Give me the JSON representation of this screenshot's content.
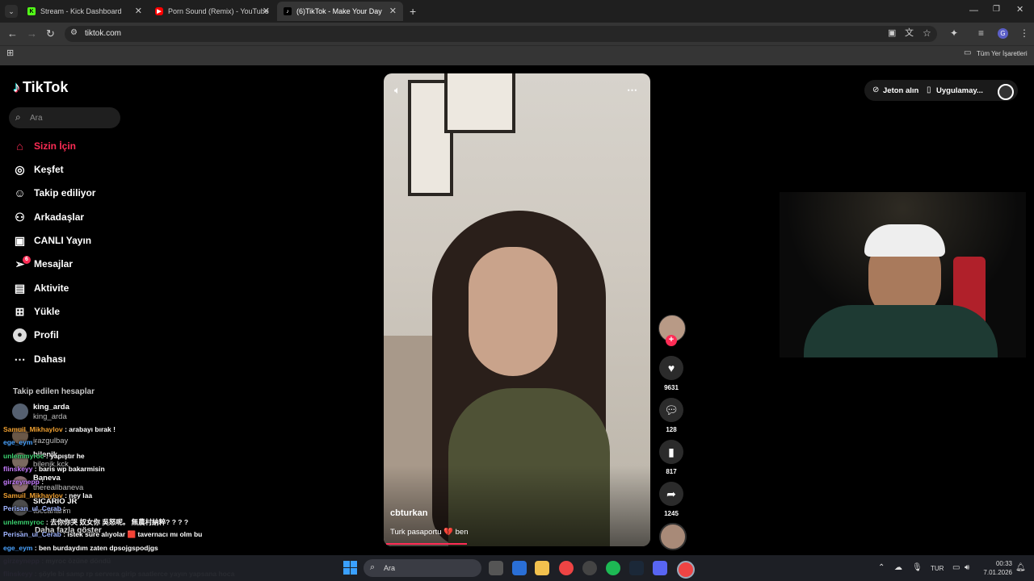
{
  "browser": {
    "tabs": [
      {
        "title": "Stream - Kick Dashboard",
        "favicon": "kick-icon",
        "color": "#53fc18"
      },
      {
        "title": "Porn Sound (Remix) - YouTube",
        "favicon": "youtube-icon",
        "color": "#ff0000"
      },
      {
        "title": "(6)TikTok - Make Your Day",
        "favicon": "tiktok-icon",
        "color": "#ffffff"
      }
    ],
    "address": "tiktok.com",
    "bookmarks_label": "Tüm Yer İşaretleri"
  },
  "tiktok": {
    "logo_text": "TikTok",
    "search_placeholder": "Ara",
    "nav": [
      {
        "label": "Sizin İçin",
        "icon": "home-icon",
        "active": true
      },
      {
        "label": "Keşfet",
        "icon": "compass-icon"
      },
      {
        "label": "Takip ediliyor",
        "icon": "following-icon"
      },
      {
        "label": "Arkadaşlar",
        "icon": "friends-icon"
      },
      {
        "label": "CANLI Yayın",
        "icon": "live-icon"
      },
      {
        "label": "Mesajlar",
        "icon": "message-icon",
        "badge": "6"
      },
      {
        "label": "Aktivite",
        "icon": "activity-icon"
      },
      {
        "label": "Yükle",
        "icon": "upload-icon"
      },
      {
        "label": "Profil",
        "icon": "profile-icon"
      },
      {
        "label": "Dahası",
        "icon": "more-icon"
      }
    ],
    "following_title": "Takip edilen hesaplar",
    "following": [
      {
        "name": "king_arda",
        "handle": "king_arda"
      },
      {
        "name": "",
        "handle": "irazgulbay"
      },
      {
        "name": "bilenik",
        "handle": "bilenik.kck"
      },
      {
        "name": "Baneva",
        "handle": "thereallbaneva"
      },
      {
        "name": "SICARIO JR",
        "handle": "tuccarlarim"
      }
    ],
    "more_label": "Daha fazla göster",
    "topbar": {
      "coins": "Jeton alın",
      "app": "Uygulamay..."
    },
    "video": {
      "author": "cbturkan",
      "caption": "Turk pasaportu 💔 ben",
      "likes": "9631",
      "comments": "128",
      "saves": "817",
      "shares": "1245"
    }
  },
  "chat": [
    {
      "user": "Samuil_Mikhaylov",
      "color": "#f0a030",
      "text": ": arabayı bırak !"
    },
    {
      "user": "ege_eym",
      "color": "#4aa3ff",
      "text": ":"
    },
    {
      "user": "unlemmyroc",
      "color": "#3bd16f",
      "text": ": yapıştır he"
    },
    {
      "user": "flinskeyy",
      "color": "#c77dff",
      "text": ": baris wp bakarmisin"
    },
    {
      "user": "girzeynepp",
      "color": "#c77dff",
      "text": ":"
    },
    {
      "user": "Samuil_Mikhaylov",
      "color": "#f0a030",
      "text": ": ney laa"
    },
    {
      "user": "Perisan_ul_Cerab",
      "color": "#9fb4ff",
      "text": ":"
    },
    {
      "user": "unlemmyroc",
      "color": "#3bd16f",
      "text": ": 去你你哭 奴女你 吳怒呢。 無農村納粹? ? ? ?"
    },
    {
      "user": "Perisan_ul_Cerab",
      "color": "#9fb4ff",
      "text": ": istek süre alıyolar 🟥 tavernacı mı olm bu"
    },
    {
      "user": "ege_eym",
      "color": "#4aa3ff",
      "text": ": ben burdaydım zaten dpsojgspodjgs"
    },
    {
      "user": "girzeynepp",
      "color": "#c77dff",
      "text": ": myroc özüne döndü"
    },
    {
      "user": "flinskeyy",
      "color": "#c77dff",
      "text": ": şöyle bi samp rp servera girip saatlerce yayın yapsana hoca"
    }
  ],
  "taskbar": {
    "search_placeholder": "Ara",
    "lang": "TUR",
    "time": "00:33",
    "date": "7.01.2026"
  }
}
